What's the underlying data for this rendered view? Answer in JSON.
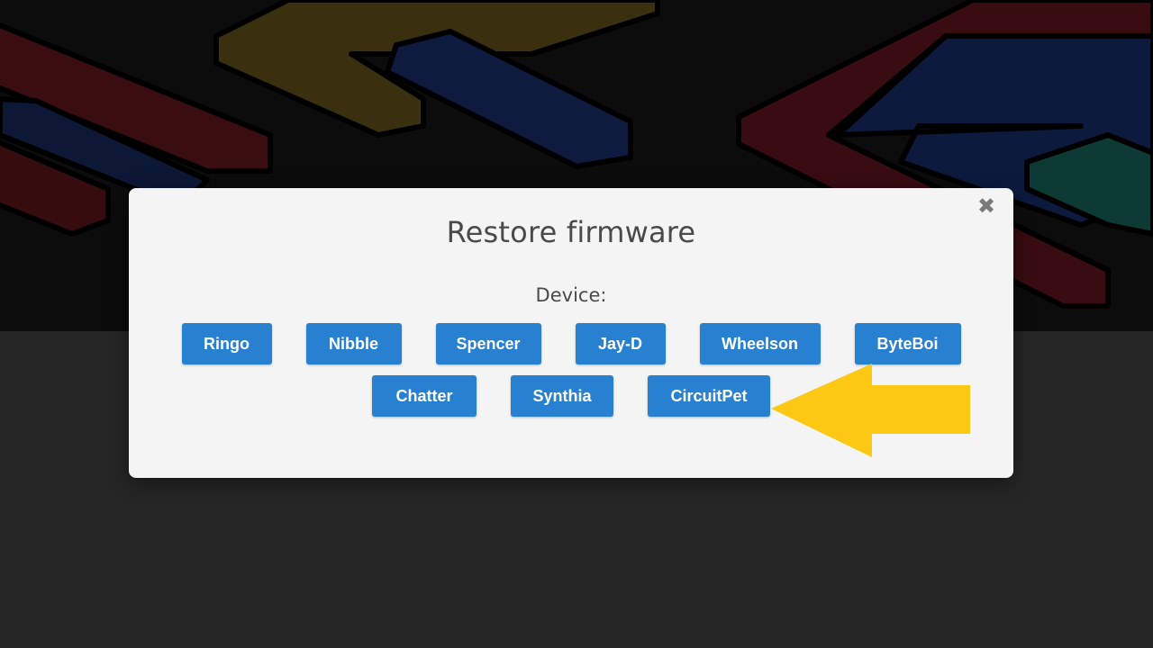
{
  "dialog": {
    "title": "Restore firmware",
    "close_symbol": "✖",
    "device_label": "Device:"
  },
  "devices_row1": [
    "Ringo",
    "Nibble",
    "Spencer",
    "Jay-D",
    "Wheelson",
    "ByteBoi"
  ],
  "devices_row2": [
    "Chatter",
    "Synthia",
    "CircuitPet"
  ],
  "colors": {
    "button": "#2781d0",
    "modal": "#f4f4f4",
    "arrow": "#fcc814",
    "page_lower": "#262626",
    "banner": "#0c0c0c"
  },
  "icons": {
    "close": "close-icon",
    "pointer": "arrow-left-icon"
  }
}
